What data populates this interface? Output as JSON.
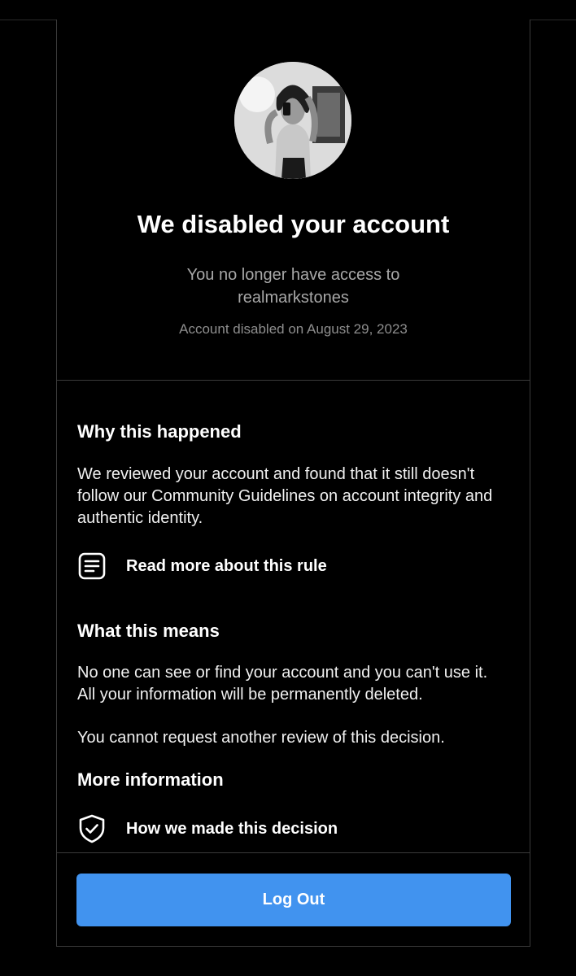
{
  "header": {
    "title": "We disabled your account",
    "subtitle_line1": "You no longer have access to",
    "subtitle_line2": "realmarkstones",
    "disabled_date": "Account disabled on August 29, 2023"
  },
  "why": {
    "heading": "Why this happened",
    "body": "We reviewed your account and found that it still doesn't follow our Community Guidelines on account integrity and authentic identity.",
    "link_label": "Read more about this rule",
    "link_icon": "document-icon"
  },
  "means": {
    "heading": "What this means",
    "body1": "No one can see or find your account and you can't use it. All your information will be permanently deleted.",
    "body2": "You cannot request another review of this decision."
  },
  "more": {
    "heading": "More information",
    "link_label": "How we made this decision",
    "link_icon": "shield-check-icon"
  },
  "footer": {
    "logout_label": "Log Out"
  },
  "colors": {
    "background": "#000000",
    "button": "#4193ef",
    "border": "#3a3a3a"
  }
}
